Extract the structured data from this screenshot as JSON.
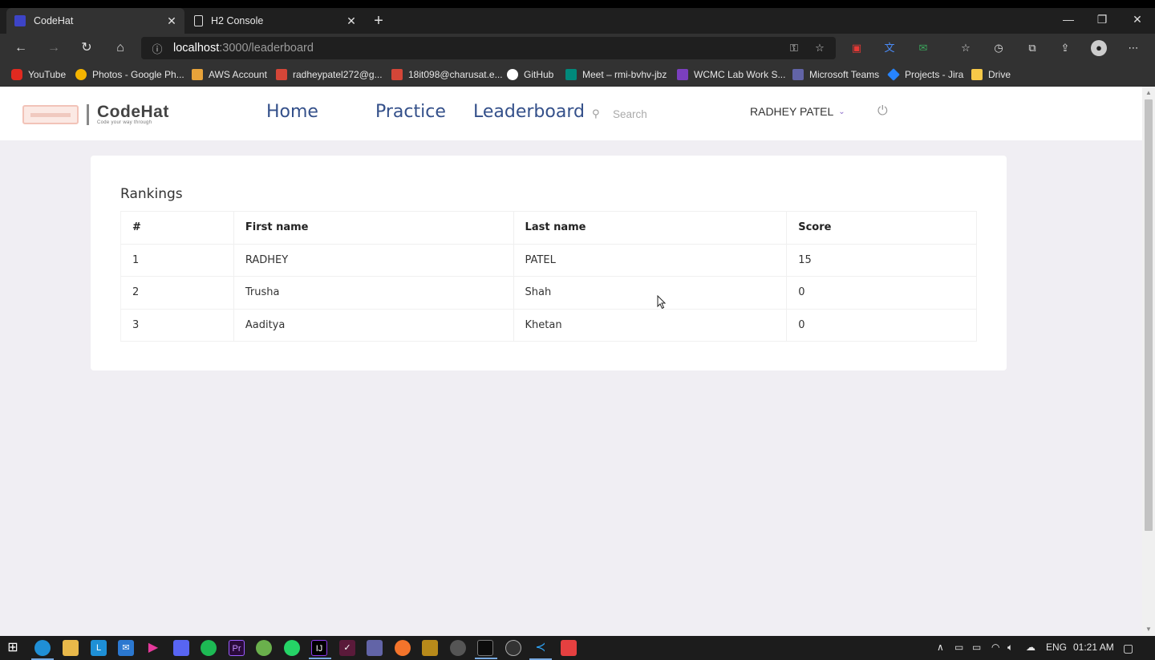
{
  "browser": {
    "tabs": [
      {
        "title": "CodeHat",
        "active": true,
        "favicon_color": "#3d44c7"
      },
      {
        "title": "H2 Console",
        "active": false
      }
    ],
    "url_host": "localhost",
    "url_path": ":3000/leaderboard",
    "bookmarks": [
      {
        "label": "YouTube",
        "icon_color": "#e02a20"
      },
      {
        "label": "Photos - Google Ph...",
        "icon_color": "#f4b400"
      },
      {
        "label": "AWS Account",
        "icon_color": "#e8a33a"
      },
      {
        "label": "radheypatel272@g...",
        "icon_color": "#d44638"
      },
      {
        "label": "18it098@charusat.e...",
        "icon_color": "#d44638"
      },
      {
        "label": "GitHub",
        "icon_color": "#ffffff"
      },
      {
        "label": "Meet – rmi-bvhv-jbz",
        "icon_color": "#00897b"
      },
      {
        "label": "WCMC Lab Work S...",
        "icon_color": "#7b3fbf"
      },
      {
        "label": "Microsoft Teams",
        "icon_color": "#6264a7"
      },
      {
        "label": "Projects - Jira",
        "icon_color": "#2684ff"
      },
      {
        "label": "Drive",
        "icon_color": "#f7c948"
      }
    ]
  },
  "app": {
    "brand": "CodeHat",
    "tagline": "Code your way through",
    "nav": {
      "home": "Home",
      "practice": "Practice",
      "leaderboard": "Leaderboard"
    },
    "search_placeholder": "Search",
    "user_name": "RADHEY PATEL"
  },
  "rankings": {
    "title": "Rankings",
    "columns": [
      "#",
      "First name",
      "Last name",
      "Score"
    ],
    "rows": [
      [
        "1",
        "RADHEY",
        "PATEL",
        "15"
      ],
      [
        "2",
        "Trusha",
        "Shah",
        "0"
      ],
      [
        "3",
        "Aaditya",
        "Khetan",
        "0"
      ]
    ]
  },
  "taskbar": {
    "language": "ENG",
    "time": "01:21 AM"
  }
}
